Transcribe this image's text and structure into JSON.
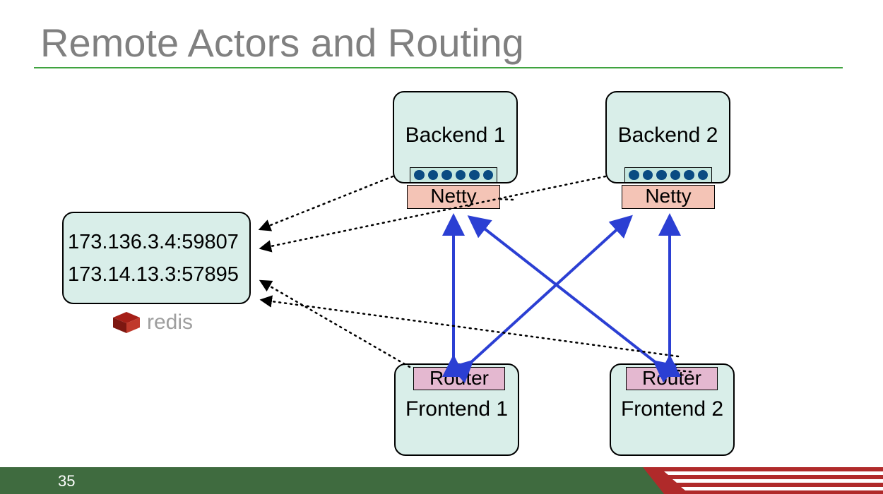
{
  "title": "Remote Actors and Routing",
  "page_number": "35",
  "redis_label": "redis",
  "redis_addresses": [
    "173.136.3.4:59807",
    "173.14.13.3:57895"
  ],
  "backends": [
    {
      "label": "Backend 1",
      "sublabel": "Netty"
    },
    {
      "label": "Backend 2",
      "sublabel": "Netty"
    }
  ],
  "frontends": [
    {
      "label": "Frontend 1",
      "router": "Router"
    },
    {
      "label": "Frontend 2",
      "router": "Router"
    }
  ],
  "colors": {
    "title": "#808080",
    "underline": "#3fa33f",
    "box_fill": "#d9eee9",
    "netty_fill": "#f4c4b6",
    "router_fill": "#e4b8d0",
    "footer": "#3f6b3f",
    "arrow": "#2b3fd3",
    "dot": "#0a4b82"
  }
}
